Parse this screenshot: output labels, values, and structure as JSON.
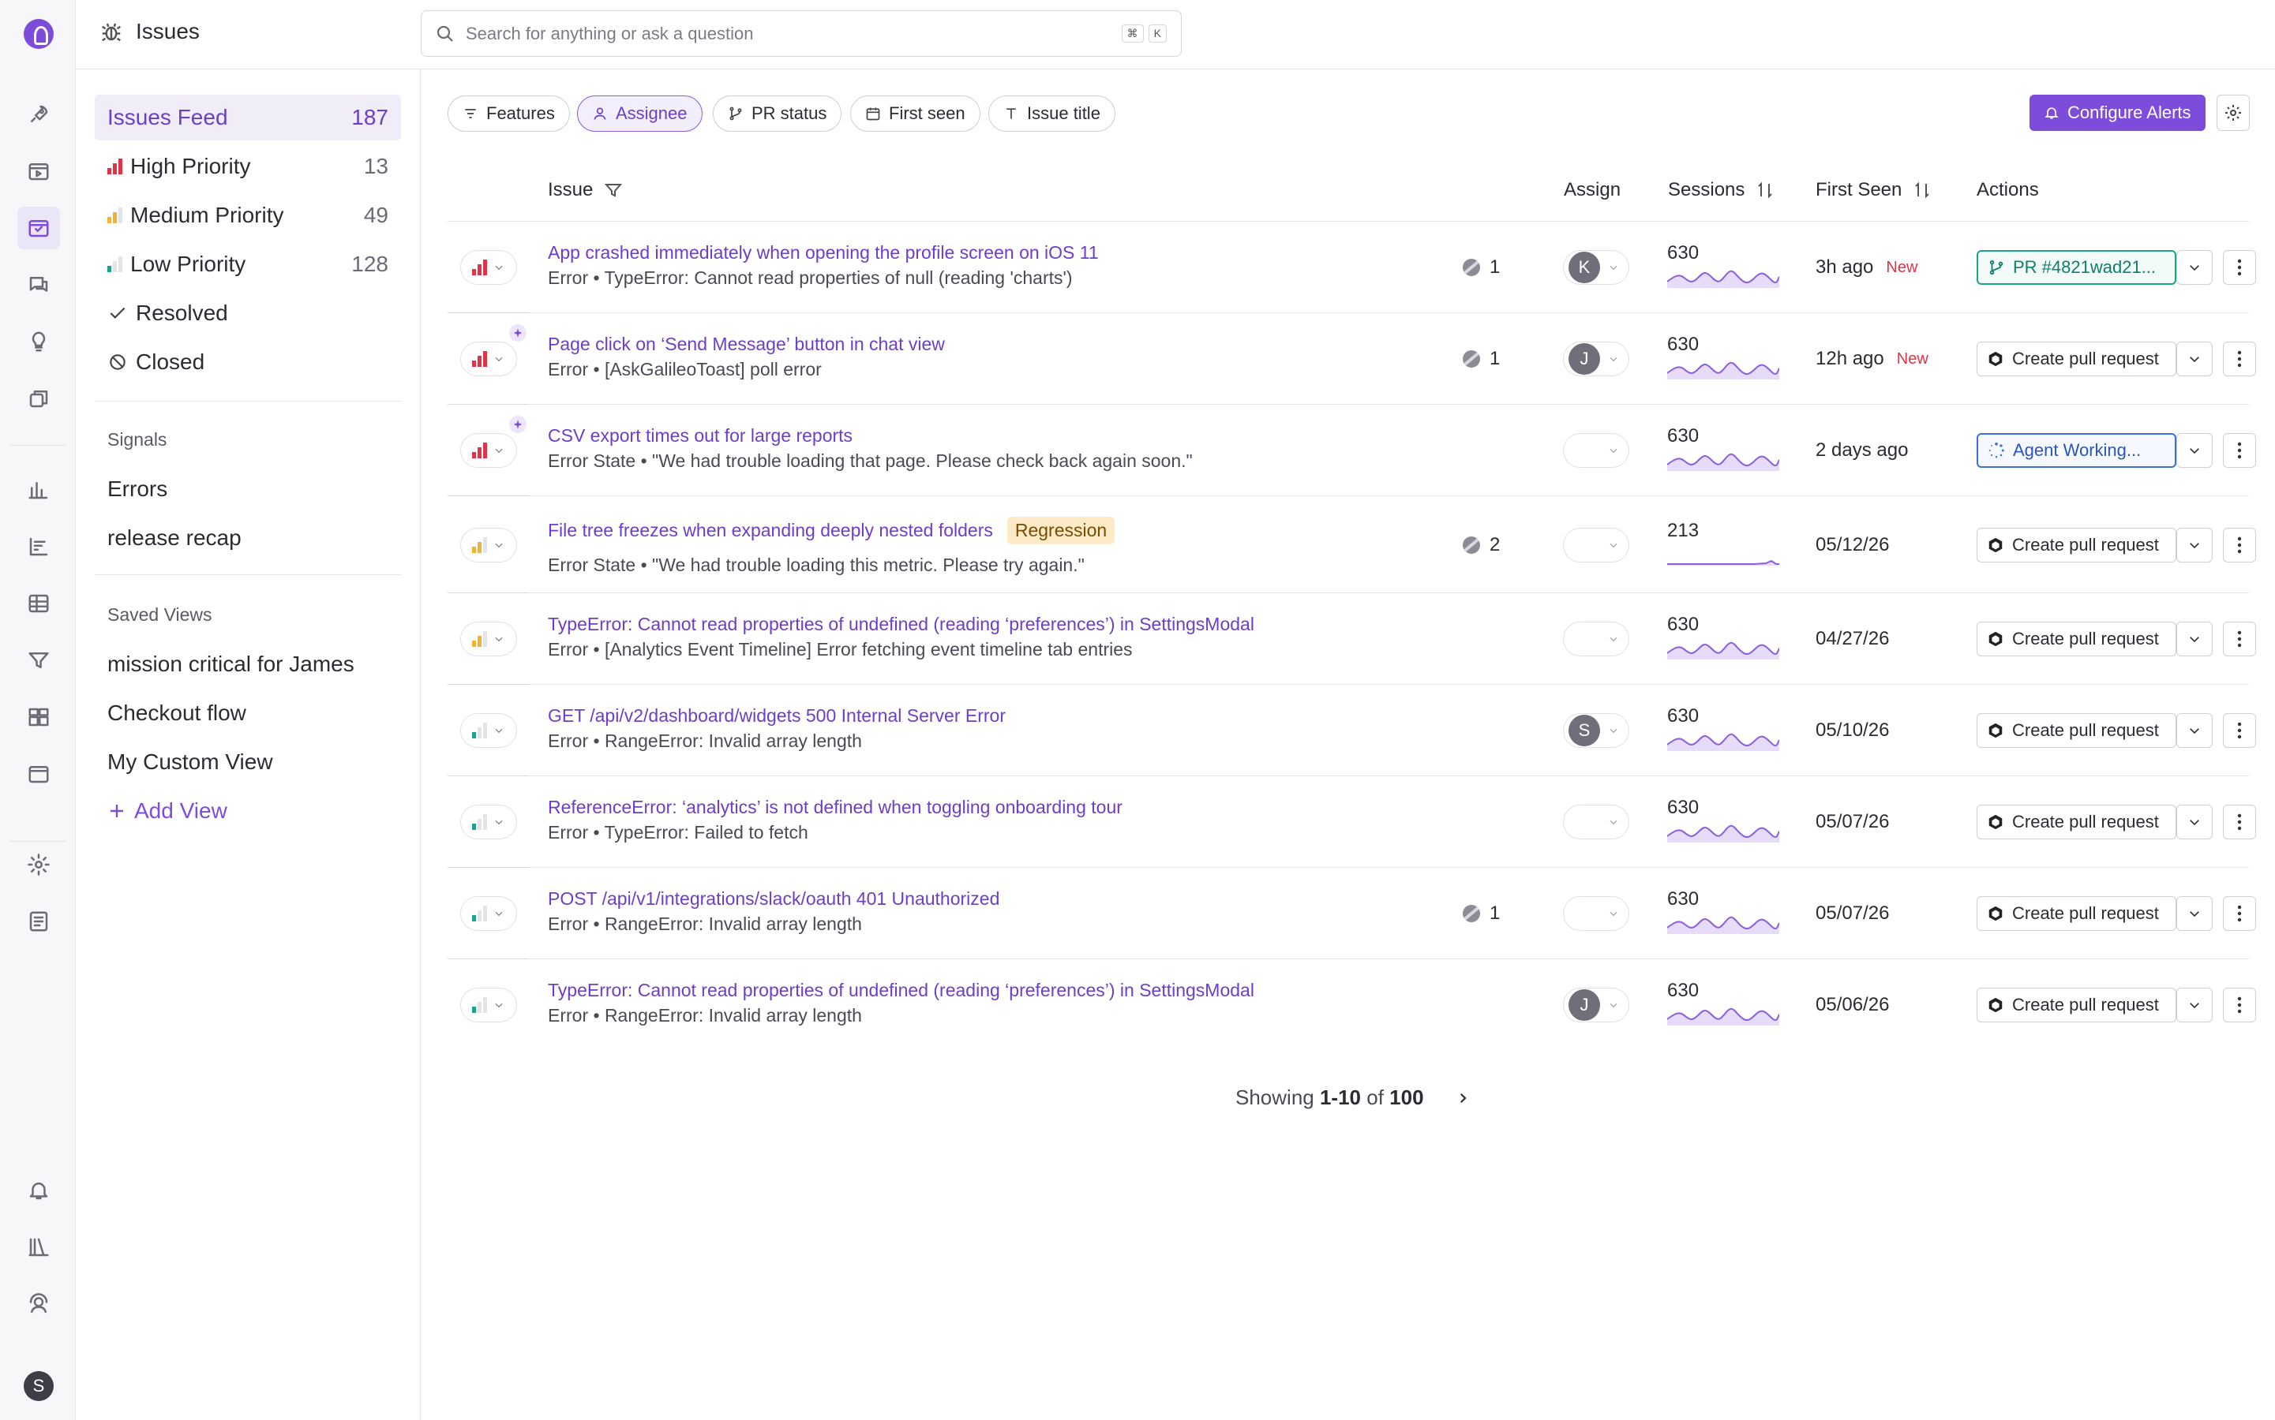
{
  "header": {
    "title": "Issues",
    "search_placeholder": "Search for anything or ask a question",
    "kbd_cmd": "⌘",
    "kbd_key": "K"
  },
  "user": {
    "initial": "S"
  },
  "sidebar": {
    "feeds": [
      {
        "label": "Issues Feed",
        "count": "187"
      },
      {
        "label": "High Priority",
        "count": "13"
      },
      {
        "label": "Medium Priority",
        "count": "49"
      },
      {
        "label": "Low Priority",
        "count": "128"
      },
      {
        "label": "Resolved"
      },
      {
        "label": "Closed"
      }
    ],
    "signals_heading": "Signals",
    "signals": [
      "Errors",
      "release recap"
    ],
    "saved_heading": "Saved Views",
    "saved": [
      "mission critical for James",
      "Checkout flow",
      "My Custom View"
    ],
    "add_view": "Add View"
  },
  "filters": [
    "Features",
    "Assignee",
    "PR status",
    "First seen",
    "Issue title"
  ],
  "configure_alerts": "Configure Alerts",
  "table": {
    "headers": {
      "issue": "Issue",
      "assign": "Assign",
      "sessions": "Sessions",
      "first_seen": "First Seen",
      "actions": "Actions"
    },
    "rows": [
      {
        "priority": "high",
        "title": "App crashed immediately when opening the profile screen on iOS 11",
        "subtitle": "Error • TypeError: Cannot read properties of null (reading 'charts')",
        "events": "1",
        "assignee": "K",
        "sessions": "630",
        "first_seen": "3h ago",
        "new": "New",
        "action": "PR #4821wad21...",
        "action_type": "pr"
      },
      {
        "priority": "high",
        "ai": true,
        "title": "Page click on ‘Send Message’ button in chat view",
        "subtitle": "Error • [AskGalileoToast] poll error",
        "events": "1",
        "assignee": "J",
        "sessions": "630",
        "first_seen": "12h ago",
        "new": "New",
        "action": "Create pull request",
        "action_type": "create"
      },
      {
        "priority": "high",
        "ai": true,
        "title": "CSV export times out for large reports",
        "subtitle": "Error State • \"We had trouble loading that page. Please check back again soon.\"",
        "sessions": "630",
        "first_seen": "2 days ago",
        "action": "Agent Working...",
        "action_type": "agent"
      },
      {
        "priority": "medium",
        "title": "File tree freezes when expanding deeply nested folders",
        "badge": "Regression",
        "subtitle": "Error State • \"We had trouble loading this metric. Please try again.\"",
        "events": "2",
        "sessions": "213",
        "first_seen": "05/12/26",
        "action": "Create pull request",
        "action_type": "create"
      },
      {
        "priority": "medium",
        "title": "TypeError: Cannot read properties of undefined (reading ‘preferences’) in SettingsModal",
        "subtitle": "Error • [Analytics Event Timeline] Error fetching event timeline tab entries",
        "sessions": "630",
        "first_seen": "04/27/26",
        "action": "Create pull request",
        "action_type": "create"
      },
      {
        "priority": "low",
        "title": "GET /api/v2/dashboard/widgets 500 Internal Server Error",
        "subtitle": "Error • RangeError: Invalid array length",
        "assignee": "S",
        "sessions": "630",
        "first_seen": "05/10/26",
        "action": "Create pull request",
        "action_type": "create"
      },
      {
        "priority": "low",
        "title": "ReferenceError: ‘analytics’ is not defined when toggling onboarding tour",
        "subtitle": "Error • TypeError: Failed to fetch",
        "sessions": "630",
        "first_seen": "05/07/26",
        "action": "Create pull request",
        "action_type": "create"
      },
      {
        "priority": "low",
        "title": "POST /api/v1/integrations/slack/oauth 401 Unauthorized",
        "subtitle": "Error • RangeError: Invalid array length",
        "events": "1",
        "sessions": "630",
        "first_seen": "05/07/26",
        "action": "Create pull request",
        "action_type": "create"
      },
      {
        "priority": "low",
        "title": "TypeError: Cannot read properties of undefined (reading ‘preferences’) in SettingsModal",
        "subtitle": "Error • RangeError: Invalid array length",
        "assignee": "J",
        "sessions": "630",
        "first_seen": "05/06/26",
        "action": "Create pull request",
        "action_type": "create"
      }
    ]
  },
  "pagination": {
    "prefix": "Showing",
    "range": "1-10",
    "of": "of",
    "total": "100"
  },
  "colors": {
    "accent": "#7d4cdb",
    "high": "#e0344b",
    "medium": "#f2b233",
    "low": "#1ca48a",
    "pr_green": "#1ca48a",
    "agent_blue": "#3b6fd8"
  }
}
